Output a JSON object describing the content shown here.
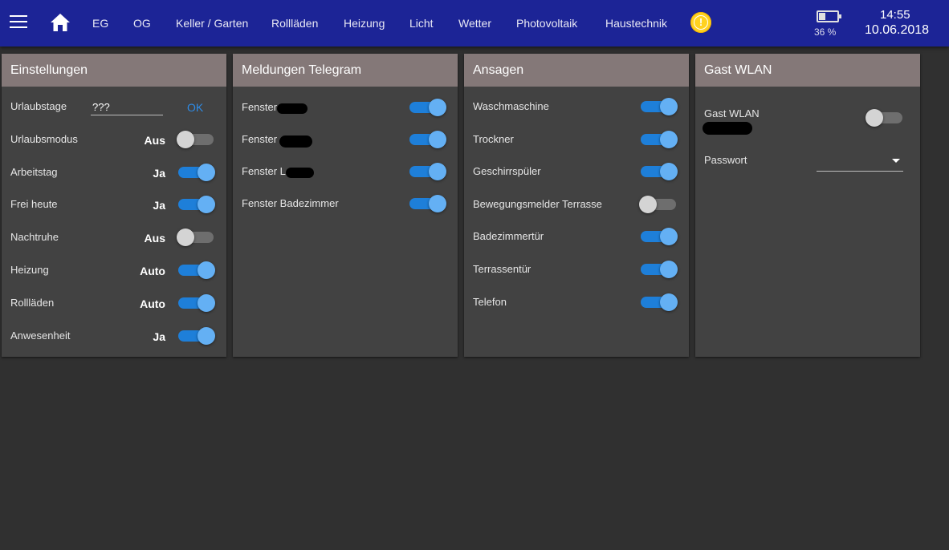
{
  "topbar": {
    "nav": [
      "EG",
      "OG",
      "Keller / Garten",
      "Rollläden",
      "Heizung",
      "Licht",
      "Wetter",
      "Photovoltaik",
      "Haustechnik"
    ],
    "warning_symbol": "!",
    "battery": {
      "level_percent": 36,
      "label": "36 %"
    },
    "time": "14:55",
    "date": "10.06.2018"
  },
  "einstellungen": {
    "title": "Einstellungen",
    "urlaubstage": {
      "label": "Urlaubstage",
      "value": "???",
      "button": "OK"
    },
    "rows": [
      {
        "label": "Urlaubsmodus",
        "value": "Aus",
        "on": false
      },
      {
        "label": "Arbeitstag",
        "value": "Ja",
        "on": true
      },
      {
        "label": "Frei heute",
        "value": "Ja",
        "on": true
      },
      {
        "label": "Nachtruhe",
        "value": "Aus",
        "on": false
      },
      {
        "label": "Heizung",
        "value": "Auto",
        "on": true
      },
      {
        "label": "Rollläden",
        "value": "Auto",
        "on": true
      },
      {
        "label": "Anwesenheit",
        "value": "Ja",
        "on": true
      }
    ]
  },
  "telegram": {
    "title": "Meldungen Telegram",
    "rows": [
      {
        "label": "Fenster",
        "on": true
      },
      {
        "label": "Fenster",
        "on": true
      },
      {
        "label": "Fenster L",
        "on": true
      },
      {
        "label": "Fenster Badezimmer",
        "on": true
      }
    ]
  },
  "ansagen": {
    "title": "Ansagen",
    "rows": [
      {
        "label": "Waschmaschine",
        "on": true
      },
      {
        "label": "Trockner",
        "on": true
      },
      {
        "label": "Geschirrspüler",
        "on": true
      },
      {
        "label": "Bewegungsmelder Terrasse",
        "on": false
      },
      {
        "label": "Badezimmertür",
        "on": true
      },
      {
        "label": "Terrassentür",
        "on": true
      },
      {
        "label": "Telefon",
        "on": true
      }
    ]
  },
  "gast_wlan": {
    "title": "Gast WLAN",
    "toggle_label": "Gast WLAN",
    "toggle_on": false,
    "password_label": "Passwort"
  },
  "colors": {
    "topbar": "#1c2496",
    "card_header": "#847878",
    "card_body": "#424242",
    "background": "#303030",
    "toggle_on_track": "#1e7fd9",
    "toggle_on_knob": "#64b0f4",
    "accent": "#2e8be6",
    "warning": "#ffd21f"
  }
}
